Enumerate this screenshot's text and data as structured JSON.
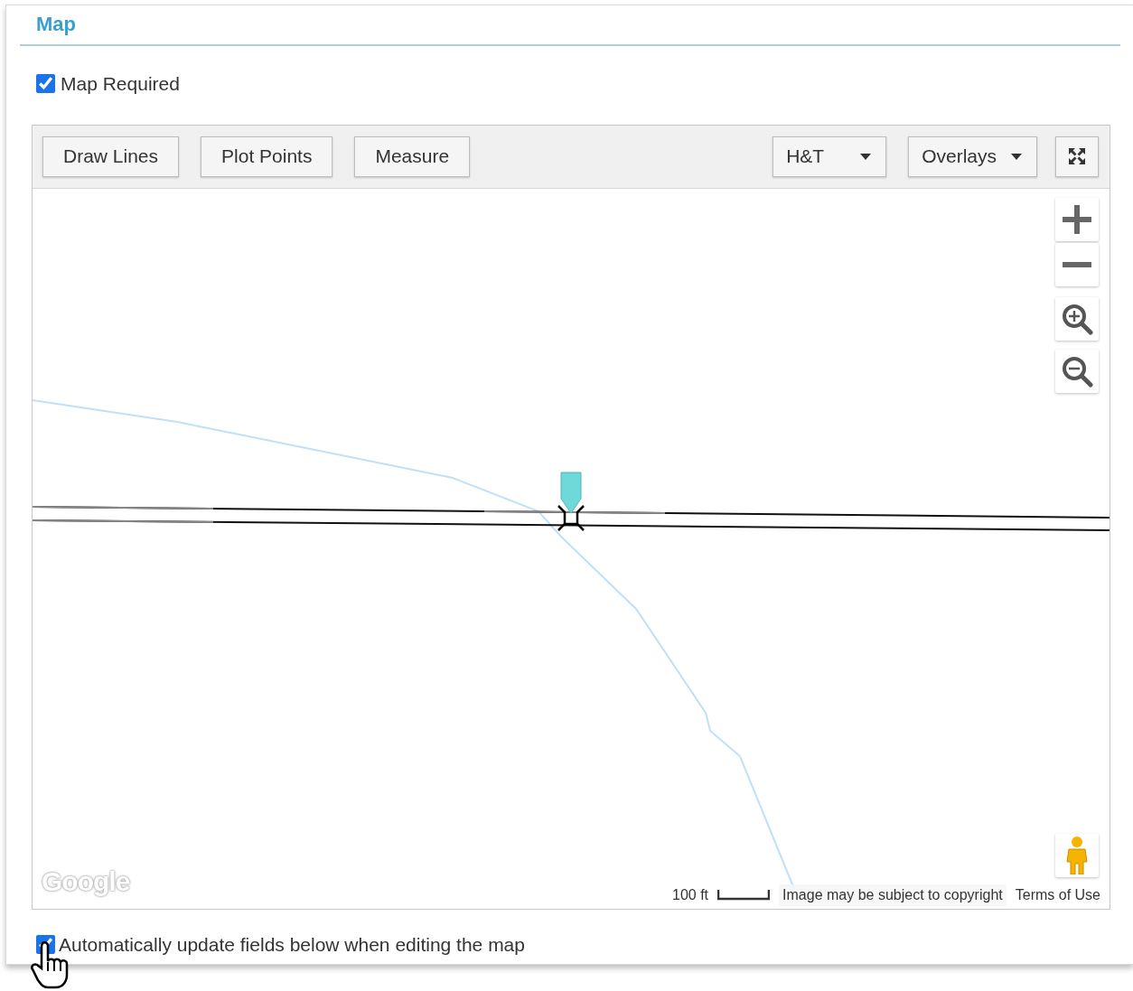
{
  "section": {
    "title": "Map"
  },
  "map_required": {
    "label": "Map Required",
    "checked": true
  },
  "toolbar": {
    "buttons": [
      {
        "kind": "button",
        "label": "Draw Lines"
      },
      {
        "kind": "button",
        "label": "Plot Points"
      },
      {
        "kind": "button",
        "label": "Measure"
      },
      {
        "kind": "dropdown",
        "label": "H&T"
      },
      {
        "kind": "dropdown",
        "label": "Overlays"
      },
      {
        "kind": "fullscreen"
      }
    ]
  },
  "map": {
    "kind": "picture",
    "logo": "Google",
    "scale": "100 ft",
    "copyright": "Image may be subject to copyright",
    "terms": "Terms of Use"
  },
  "auto_update": {
    "label": "Automatically update fields below when editing the map",
    "checked": true
  }
}
